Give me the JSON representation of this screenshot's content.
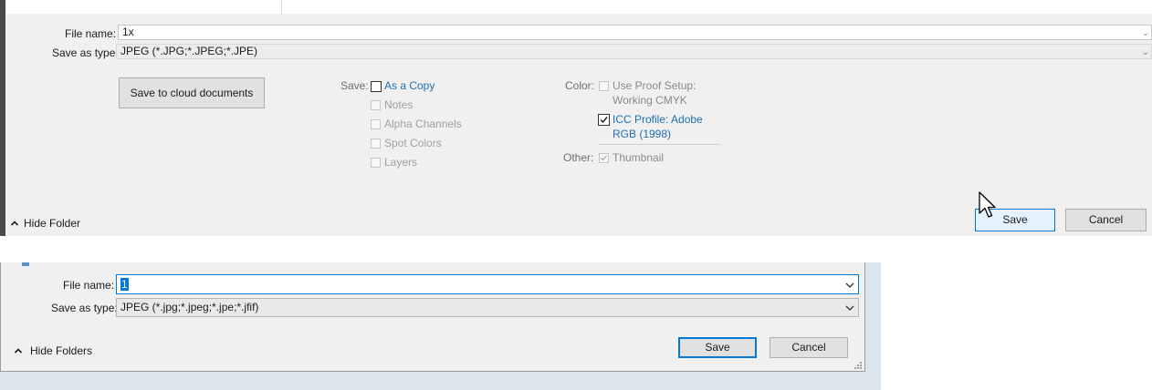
{
  "panel1": {
    "file_name_label": "File name:",
    "file_name_value": "1x",
    "save_as_type_label": "Save as type:",
    "save_as_type_value": "JPEG (*.JPG;*.JPEG;*.JPE)",
    "cloud_button": "Save to cloud documents",
    "save_group_label": "Save:",
    "save_options": [
      {
        "label": "As a Copy",
        "checked": false,
        "enabled": true
      },
      {
        "label": "Notes",
        "checked": false,
        "enabled": false
      },
      {
        "label": "Alpha Channels",
        "checked": false,
        "enabled": false
      },
      {
        "label": "Spot Colors",
        "checked": false,
        "enabled": false
      },
      {
        "label": "Layers",
        "checked": false,
        "enabled": false
      }
    ],
    "color_group_label": "Color:",
    "proof_setup_line1": "Use Proof Setup:",
    "proof_setup_line2": "Working CMYK",
    "icc_line1": "ICC Profile:  Adobe",
    "icc_line2": "RGB (1998)",
    "icc_checked": true,
    "other_group_label": "Other:",
    "thumbnail_label": "Thumbnail",
    "thumbnail_checked": true,
    "hide_folder": "Hide Folder",
    "save_button": "Save",
    "cancel_button": "Cancel"
  },
  "panel2": {
    "file_name_label": "File name:",
    "file_name_value": "1",
    "save_as_type_label": "Save as type:",
    "save_as_type_value": "JPEG (*.jpg;*.jpeg;*.jpe;*.jfif)",
    "hide_folders": "Hide Folders",
    "save_button": "Save",
    "cancel_button": "Cancel"
  },
  "icons": {
    "chevron_up": "chevron-up-icon",
    "chevron_down": "chevron-down-icon",
    "checkmark": "checkmark-icon",
    "cursor": "mouse-cursor-icon",
    "grip": "resize-grip-icon"
  },
  "colors": {
    "accent": "#0078d7",
    "link_blue": "#1f6fb2",
    "panel_bg": "#f0f0f0"
  }
}
